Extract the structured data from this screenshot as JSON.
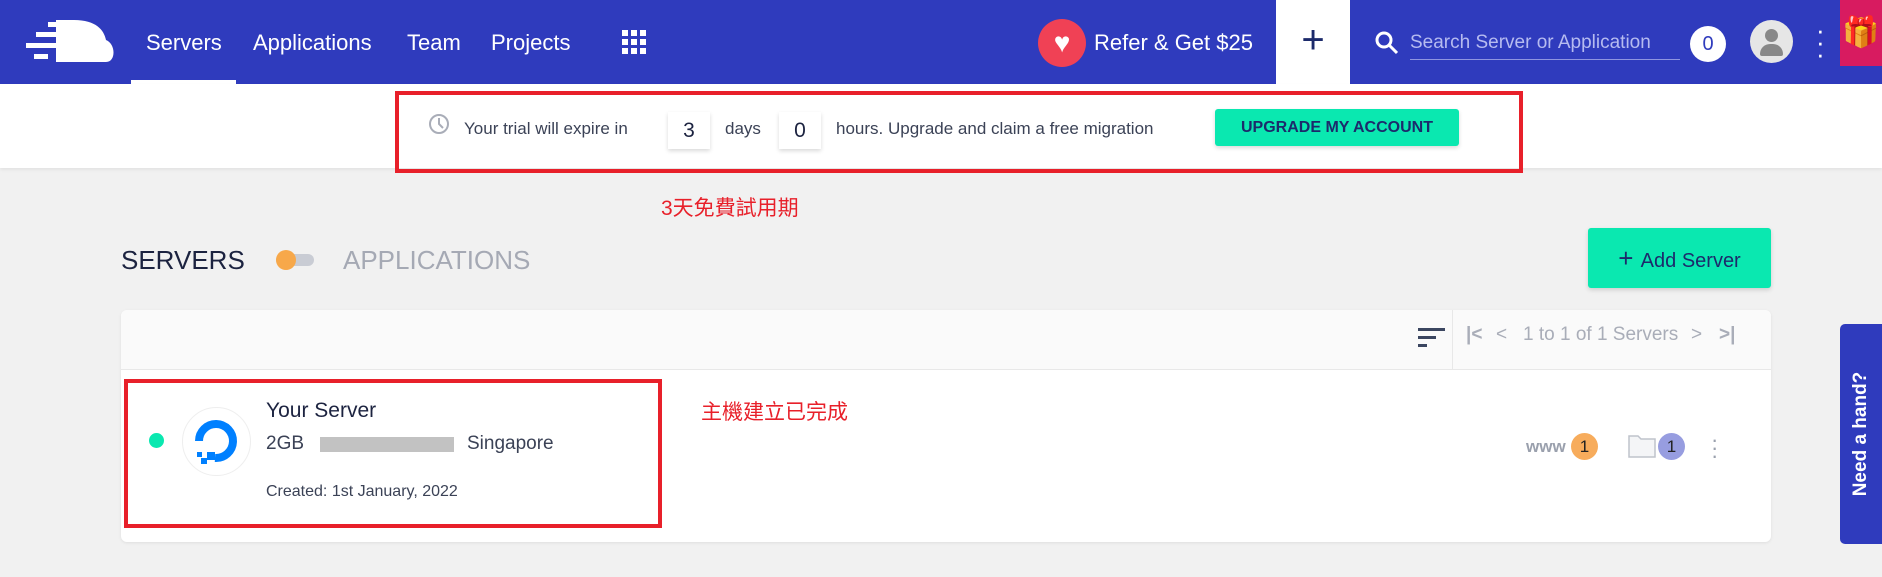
{
  "nav": {
    "links": [
      "Servers",
      "Applications",
      "Team",
      "Projects"
    ],
    "refer_label": "Refer & Get $25",
    "search_placeholder": "Search Server or Application",
    "notification_count": "0",
    "colors": {
      "bar": "#2f3bbd",
      "refer": "#f04155",
      "gift": "#d81b60"
    }
  },
  "trial": {
    "prefix": "Your trial will expire in",
    "days": "3",
    "days_label": "days",
    "hours": "0",
    "suffix": "hours. Upgrade and claim a free migration",
    "button": "UPGRADE MY ACCOUNT"
  },
  "annotations": {
    "trial": "3天免費試用期",
    "server": "主機建立已完成"
  },
  "section": {
    "servers_tab": "SERVERS",
    "applications_tab": "APPLICATIONS",
    "add_button": "Add Server"
  },
  "pagination": {
    "text": "1 to 1 of 1 Servers"
  },
  "server": {
    "name": "Your Server",
    "size": "2GB",
    "location": "Singapore",
    "created": "Created: 1st January, 2022",
    "status": "running",
    "www_count": "1",
    "folder_count": "1"
  },
  "help": {
    "label": "Need a hand?"
  }
}
